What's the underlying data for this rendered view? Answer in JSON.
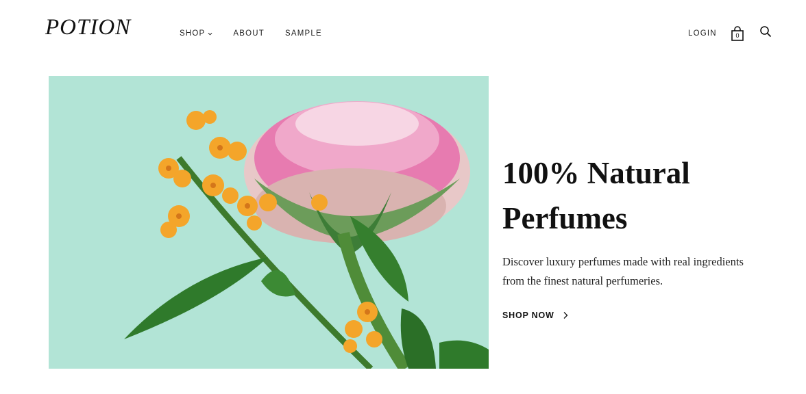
{
  "header": {
    "logo": "POTION",
    "nav": [
      {
        "label": "SHOP",
        "has_dropdown": true
      },
      {
        "label": "ABOUT"
      },
      {
        "label": "SAMPLE"
      }
    ],
    "login_label": "LOGIN",
    "cart_count": "0",
    "icons": [
      "chevron-down-icon",
      "shopping-bag-icon",
      "search-icon"
    ]
  },
  "hero": {
    "image_subject": "pink gerbera and orange flowers on mint background",
    "title_line1": "100% Natural",
    "title_line2": "Perfumes",
    "description_line1": "Discover luxury perfumes made with real ingredients",
    "description_line2": "from the finest natural perfumeries.",
    "cta_label": "SHOP NOW",
    "cta_icon": "chevron-right-icon"
  },
  "colors": {
    "background": "#ffffff",
    "text": "#111111",
    "hero_bg": "#b2e4d6",
    "petal_pink": "#e05c9b",
    "flower_orange": "#f4a52a",
    "leaf_green": "#2f7a2b"
  }
}
